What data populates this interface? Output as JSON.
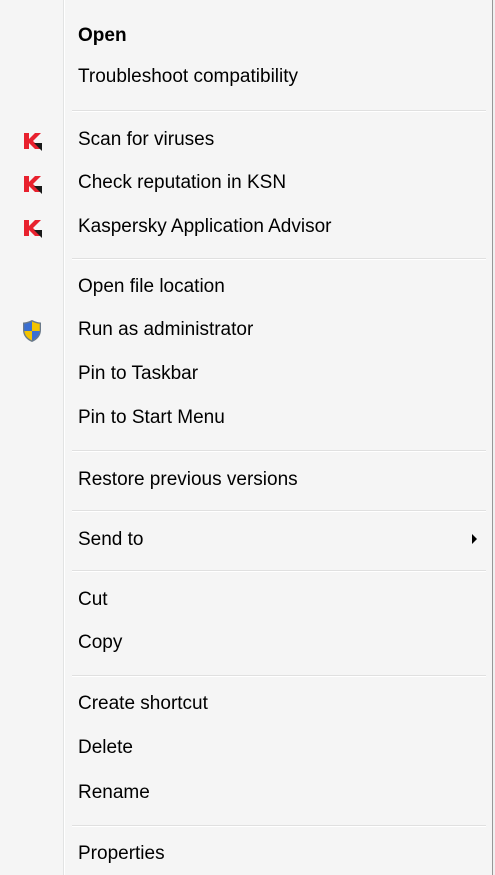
{
  "menu": {
    "items": {
      "open": "Open",
      "troubleshoot": "Troubleshoot compatibility",
      "scan": "Scan for viruses",
      "reputation": "Check reputation in KSN",
      "advisor": "Kaspersky Application Advisor",
      "open_location": "Open file location",
      "run_admin": "Run as administrator",
      "pin_taskbar": "Pin to Taskbar",
      "pin_start": "Pin to Start Menu",
      "restore": "Restore previous versions",
      "send_to": "Send to",
      "cut": "Cut",
      "copy": "Copy",
      "create_shortcut": "Create shortcut",
      "delete": "Delete",
      "rename": "Rename",
      "properties": "Properties"
    },
    "icons": {
      "kaspersky": "kaspersky-icon",
      "uac_shield": "uac-shield-icon",
      "submenu_arrow": "chevron-right-icon"
    },
    "colors": {
      "kaspersky_red": "#e8212e",
      "shield_blue": "#3b6fd1",
      "shield_yellow": "#f3c400"
    }
  }
}
